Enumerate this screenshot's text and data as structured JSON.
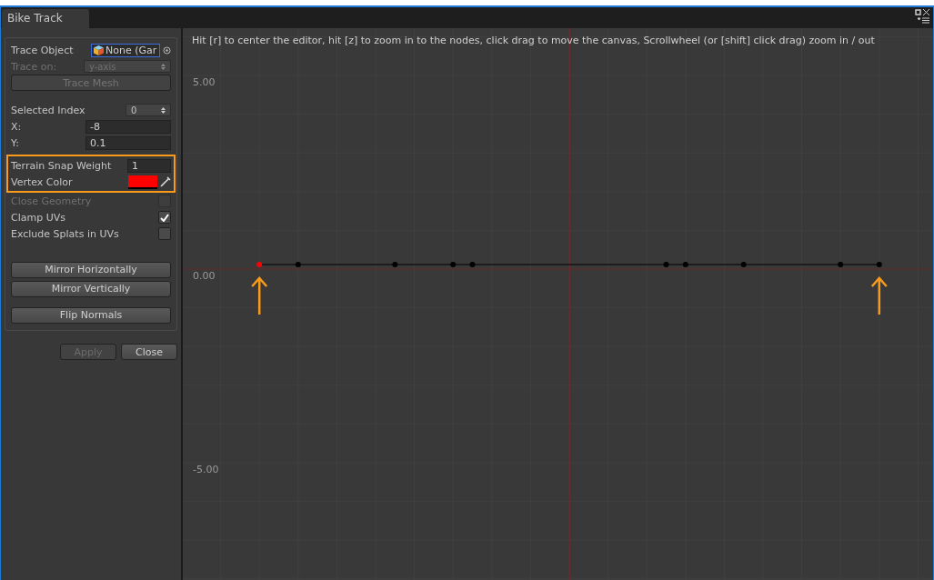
{
  "window": {
    "tab": "Bike Track"
  },
  "inspector": {
    "trace_object": {
      "label": "Trace Object",
      "value": "None (Gar"
    },
    "trace_on": {
      "label": "Trace on:",
      "value": "y-axis",
      "disabled": true
    },
    "trace_mesh": {
      "label": "Trace Mesh",
      "disabled": true
    },
    "selected_index": {
      "label": "Selected Index",
      "value": "0"
    },
    "x": {
      "label": "X:",
      "value": "-8"
    },
    "y": {
      "label": "Y:",
      "value": "0.1"
    },
    "terrain_snap_weight": {
      "label": "Terrain Snap Weight",
      "value": "1"
    },
    "vertex_color": {
      "label": "Vertex Color",
      "color": "#ff0000"
    },
    "toggles": [
      {
        "label": "Close Geometry",
        "checked": false
      },
      {
        "label": "Clamp UVs",
        "checked": true
      },
      {
        "label": "Exclude Splats in UVs",
        "checked": false
      }
    ],
    "buttons": [
      {
        "label": "Mirror Horizontally"
      },
      {
        "label": "Mirror Vertically"
      },
      {
        "label": "Flip Normals"
      }
    ]
  },
  "footer_buttons": [
    {
      "label": "Apply",
      "disabled": true
    },
    {
      "label": "Close",
      "disabled": false
    }
  ],
  "canvas": {
    "hint": "Hit [r] to center the editor, hit [z] to zoom in to the nodes, click drag to move the canvas, Scrollwheel (or [shift] click drag) zoom in / out",
    "y_labels": [
      "5.00",
      "0.00",
      "-5.00"
    ],
    "nodes": [
      {
        "selected": true
      },
      {
        "selected": false
      },
      {
        "selected": false
      },
      {
        "selected": false
      },
      {
        "selected": false
      },
      {
        "selected": false
      },
      {
        "selected": false
      },
      {
        "selected": false
      },
      {
        "selected": false
      },
      {
        "selected": false
      }
    ]
  }
}
